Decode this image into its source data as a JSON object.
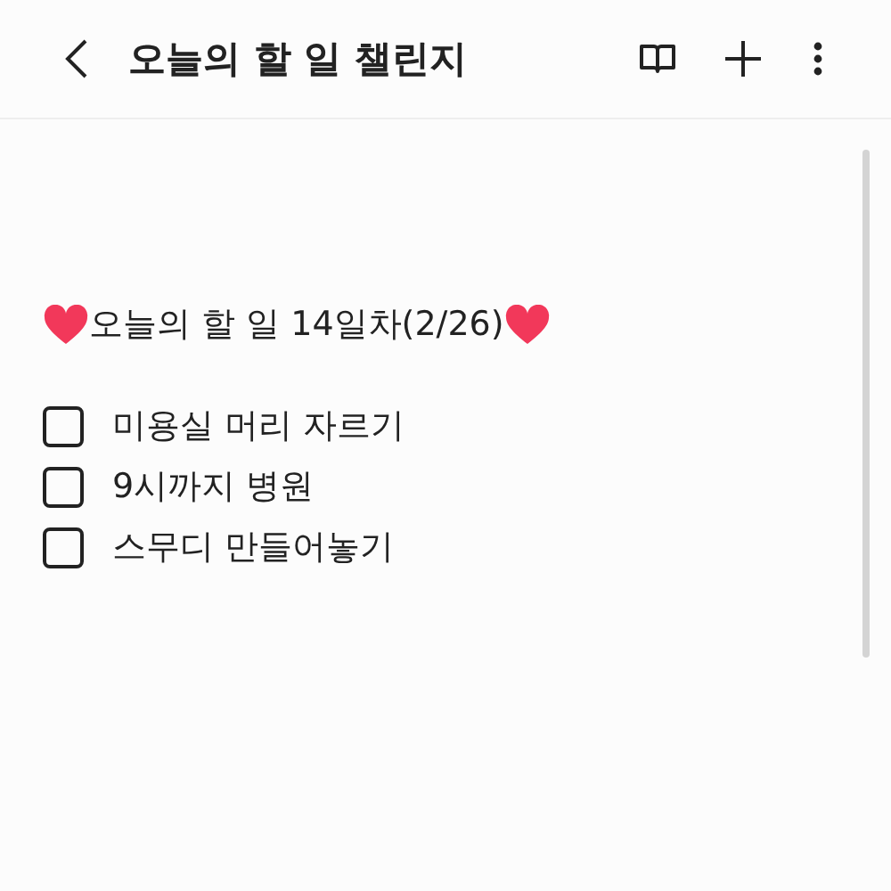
{
  "header": {
    "title": "오늘의 할 일 챌린지"
  },
  "note": {
    "heading": "오늘의 할 일 14일차(2/26)",
    "items": [
      {
        "text": "미용실 머리 자르기",
        "checked": false
      },
      {
        "text": "9시까지 병원",
        "checked": false
      },
      {
        "text": "스무디 만들어놓기",
        "checked": false
      }
    ]
  }
}
